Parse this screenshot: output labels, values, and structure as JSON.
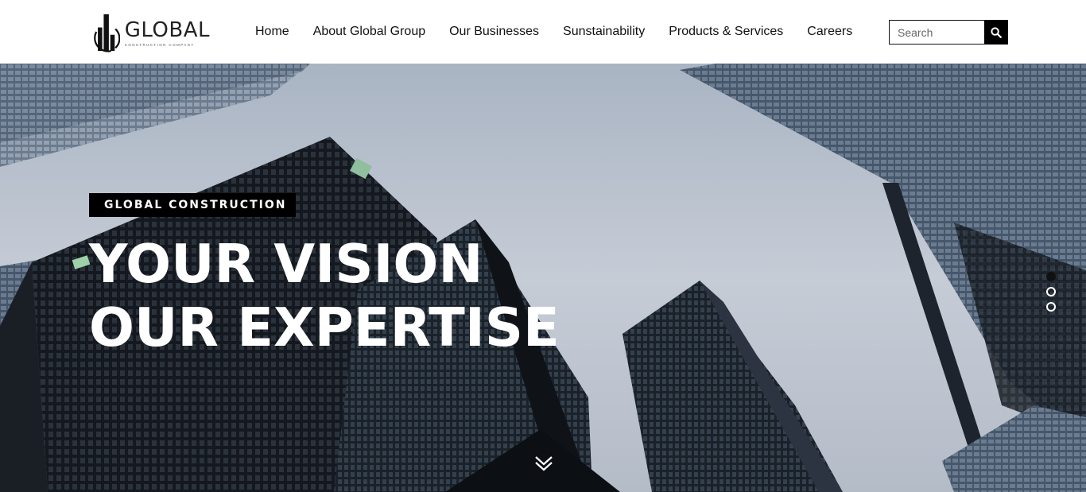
{
  "header": {
    "logo": {
      "name": "GLOBAL",
      "tagline": "CONSTRUCTION COMPANY"
    },
    "nav": [
      {
        "label": "Home"
      },
      {
        "label": "About Global Group"
      },
      {
        "label": "Our Businesses"
      },
      {
        "label": "Sunstainability"
      },
      {
        "label": "Products & Services"
      },
      {
        "label": "Careers"
      }
    ],
    "search": {
      "placeholder": "Search",
      "icon": "search-icon"
    }
  },
  "hero": {
    "badge": "GLOBAL CONSTRUCTION",
    "headline_line1": "YOUR VISION",
    "headline_line2": "OUR EXPERTISE",
    "slides": {
      "count": 3,
      "active": 1
    },
    "scroll_icon": "double-chevron-down-icon"
  },
  "colors": {
    "header_bg": "#ffffff",
    "text": "#111111",
    "badge_bg": "#000000",
    "headline": "#ffffff",
    "sky": "#c3cad4"
  }
}
